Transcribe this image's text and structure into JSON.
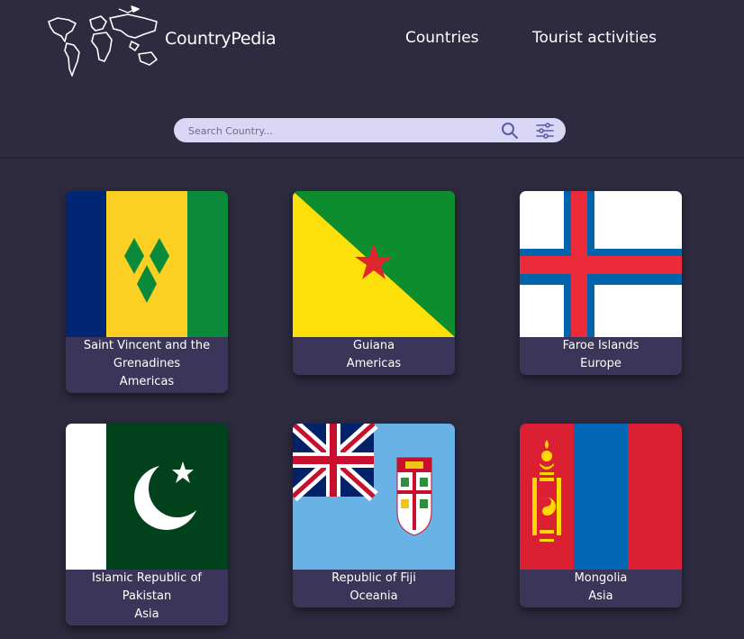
{
  "header": {
    "brand": "CountryPedia",
    "nav": [
      {
        "label": "Countries"
      },
      {
        "label": "Tourist activities"
      }
    ]
  },
  "search": {
    "placeholder": "Search Country...",
    "value": ""
  },
  "icons": {
    "logo": "world-map-airplane-icon",
    "search": "search-icon",
    "filter": "sliders-filter-icon"
  },
  "countries": [
    {
      "name": "Saint Vincent and the Grenadines",
      "region": "Americas",
      "flag": "saint-vincent-flag"
    },
    {
      "name": "Guiana",
      "region": "Americas",
      "flag": "french-guiana-flag"
    },
    {
      "name": "Faroe Islands",
      "region": "Europe",
      "flag": "faroe-islands-flag"
    },
    {
      "name": "Islamic Republic of Pakistan",
      "region": "Asia",
      "flag": "pakistan-flag"
    },
    {
      "name": "Republic of Fiji",
      "region": "Oceania",
      "flag": "fiji-flag"
    },
    {
      "name": "Mongolia",
      "region": "Asia",
      "flag": "mongolia-flag"
    }
  ],
  "colors": {
    "background": "#2e2b40",
    "card_caption": "#3b3659",
    "search_bg": "#d9d6f6",
    "accent": "#5d5aa8"
  }
}
